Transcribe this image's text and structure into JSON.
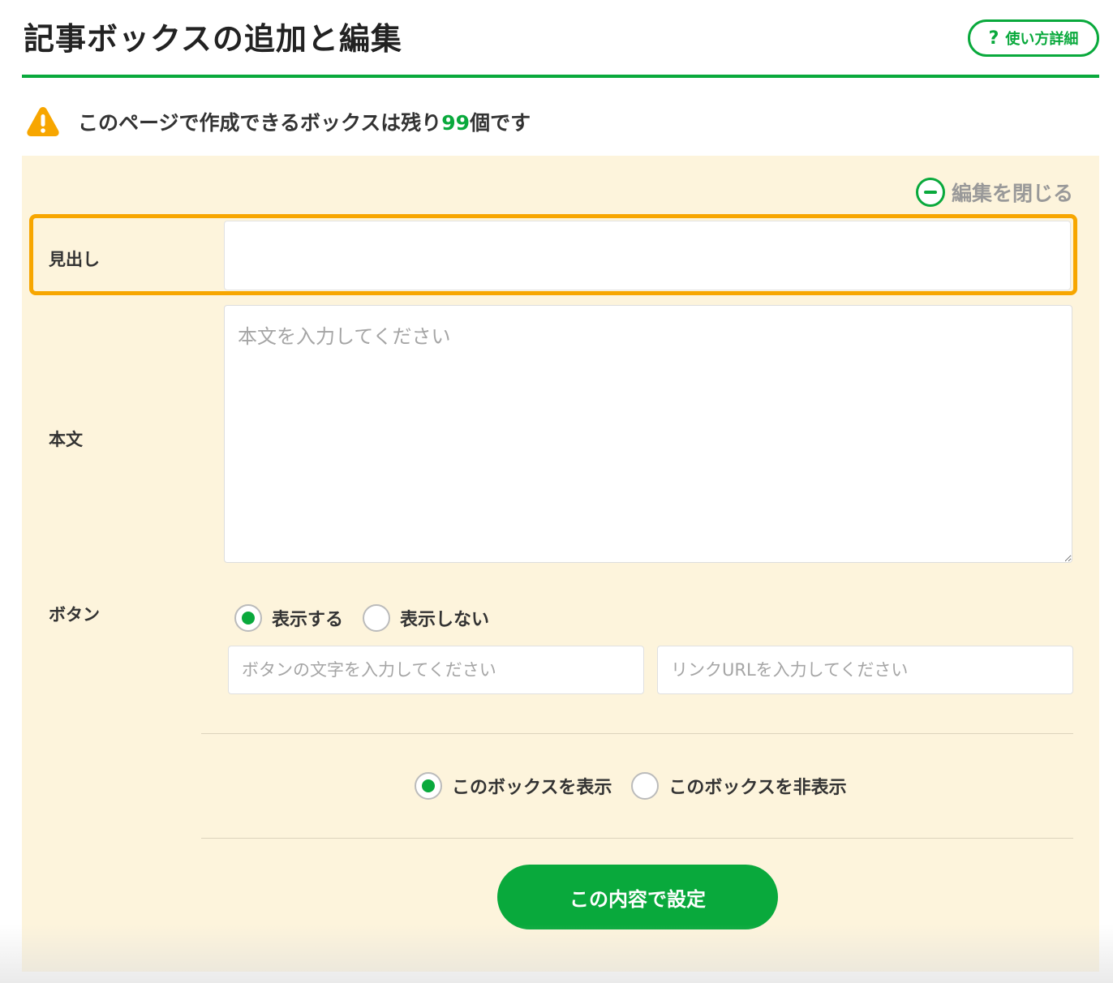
{
  "header": {
    "title": "記事ボックスの追加と編集",
    "help_button": {
      "icon": "question-icon",
      "icon_glyph": "?",
      "label": "使い方詳細"
    }
  },
  "notice": {
    "icon": "warning-icon",
    "text_before": "このページで作成できるボックスは残り",
    "count": "99",
    "text_after": "個です"
  },
  "panel": {
    "close_edit": {
      "icon": "minus-circle-icon",
      "label": "編集を閉じる"
    },
    "heading": {
      "label": "見出し",
      "value": "",
      "placeholder": ""
    },
    "body": {
      "label": "本文",
      "value": "",
      "placeholder": "本文を入力してください"
    },
    "button_setting": {
      "label": "ボタン",
      "options": [
        {
          "label": "表示する",
          "checked": true
        },
        {
          "label": "表示しない",
          "checked": false
        }
      ],
      "text_placeholder": "ボタンの文字を入力してください",
      "url_placeholder": "リンクURLを入力してください"
    },
    "visibility": {
      "options": [
        {
          "label": "このボックスを表示",
          "checked": true
        },
        {
          "label": "このボックスを非表示",
          "checked": false
        }
      ]
    },
    "submit_label": "この内容で設定"
  },
  "colors": {
    "accent": "#09a93c",
    "highlight": "#f7a600",
    "panel_bg": "#fdf4dc",
    "muted_text": "#999999"
  }
}
